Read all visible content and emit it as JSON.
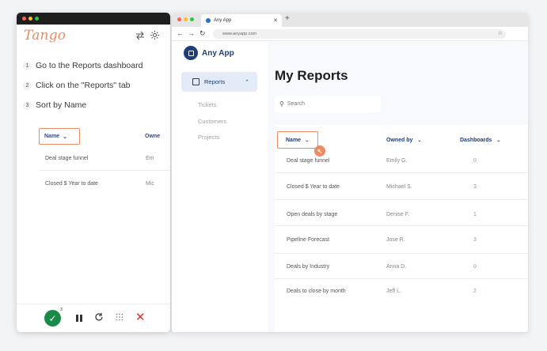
{
  "tango": {
    "logo": "Tango",
    "steps": [
      {
        "num": "1",
        "text": "Go to the Reports dashboard"
      },
      {
        "num": "2",
        "text": "Click on the \"Reports\" tab"
      },
      {
        "num": "3",
        "text": "Sort by Name"
      }
    ],
    "preview": {
      "name_header": "Name",
      "owned_header": "Owne",
      "rows": [
        {
          "name": "Deal stage funnel",
          "owner": "Em"
        },
        {
          "name": "Closed $ Year to date",
          "owner": "Mic"
        }
      ]
    },
    "badge": "3"
  },
  "browser": {
    "tab_title": "Any App",
    "url": "www.anyapp.com"
  },
  "app": {
    "brand": "Any App",
    "nav": {
      "active": "Reports",
      "items": [
        "Tickets",
        "Customers",
        "Projects"
      ]
    },
    "page_title": "My Reports",
    "search_placeholder": "Search",
    "columns": {
      "name": "Name",
      "owned_by": "Owned by",
      "dashboards": "Dashboards"
    },
    "rows": [
      {
        "name": "Deal stage funnel",
        "owner": "Emily G.",
        "dashboards": "0"
      },
      {
        "name": "Closed $ Year to date",
        "owner": "Michael S.",
        "dashboards": "3"
      },
      {
        "name": "Open deals by stage",
        "owner": "Denise F.",
        "dashboards": "1"
      },
      {
        "name": "Pipeline Forecast",
        "owner": "Jose R.",
        "dashboards": "3"
      },
      {
        "name": "Deals by Industry",
        "owner": "Anna D.",
        "dashboards": "0"
      },
      {
        "name": "Deals to close by month",
        "owner": "Jeff L.",
        "dashboards": "2"
      }
    ]
  },
  "colors": {
    "accent": "#f08a60",
    "brand": "#1d3e7a",
    "success": "#1a8a4a",
    "danger": "#d93030"
  }
}
